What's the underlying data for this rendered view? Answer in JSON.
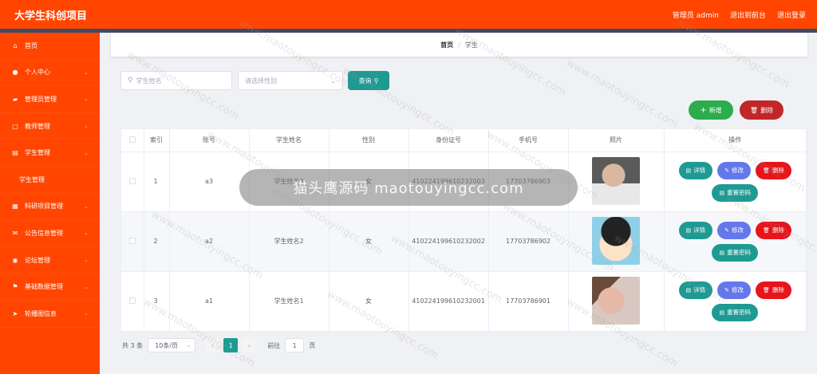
{
  "header": {
    "title": "大学生科创项目",
    "admin_label": "管理员 admin",
    "back_label": "退出到前台",
    "logout_label": "退出登录"
  },
  "sidebar": {
    "items": [
      {
        "label": "首页",
        "icon": "home-icon",
        "glyph": "⌂",
        "sub": false,
        "chevron": false
      },
      {
        "label": "个人中心",
        "icon": "user-icon",
        "glyph": "●",
        "sub": false,
        "chevron": true
      },
      {
        "label": "管理员管理",
        "icon": "admin-icon",
        "glyph": "▰",
        "sub": false,
        "chevron": true
      },
      {
        "label": "教师管理",
        "icon": "teacher-icon",
        "glyph": "□",
        "sub": false,
        "chevron": true
      },
      {
        "label": "学生管理",
        "icon": "student-icon",
        "glyph": "▤",
        "sub": false,
        "chevron": true
      },
      {
        "label": "学生管理",
        "icon": "",
        "glyph": "",
        "sub": true,
        "chevron": false
      },
      {
        "label": "科研项目管理",
        "icon": "project-icon",
        "glyph": "▦",
        "sub": false,
        "chevron": true
      },
      {
        "label": "公告信息管理",
        "icon": "notice-icon",
        "glyph": "✉",
        "sub": false,
        "chevron": true
      },
      {
        "label": "论坛管理",
        "icon": "forum-icon",
        "glyph": "◉",
        "sub": false,
        "chevron": true
      },
      {
        "label": "基础数据管理",
        "icon": "flag-icon",
        "glyph": "⚑",
        "sub": false,
        "chevron": true
      },
      {
        "label": "轮播图信息",
        "icon": "send-icon",
        "glyph": "➤",
        "sub": false,
        "chevron": true
      }
    ]
  },
  "breadcrumb": {
    "home": "首页",
    "separator": "/",
    "current": "学生"
  },
  "search": {
    "placeholder": "学生姓名",
    "gender_placeholder": "请选择性别",
    "query_label": "查询"
  },
  "actions": {
    "add_label": "新增",
    "delete_label": "删除"
  },
  "table": {
    "headers": [
      "",
      "索引",
      "账号",
      "学生姓名",
      "性别",
      "身份证号",
      "手机号",
      "照片",
      "操作"
    ],
    "rows": [
      {
        "index": "1",
        "account": "a3",
        "name": "学生姓名3",
        "gender": "女",
        "id_card": "410224199610232003",
        "phone": "17703786903",
        "photo": "photo-man-mirror"
      },
      {
        "index": "2",
        "account": "a2",
        "name": "学生姓名2",
        "gender": "女",
        "id_card": "410224199610232002",
        "phone": "17703786902",
        "photo": "photo-cartoon-boy"
      },
      {
        "index": "3",
        "account": "a1",
        "name": "学生姓名1",
        "gender": "女",
        "id_card": "410224199610232001",
        "phone": "17703786901",
        "photo": "photo-woman-lying"
      }
    ],
    "op_labels": {
      "detail": "详情",
      "edit": "修改",
      "delete": "删除",
      "reset": "重置密码"
    }
  },
  "pagination": {
    "total": "共 3 条",
    "page_size": "10条/页",
    "current_page": "1",
    "goto": "前往",
    "goto_value": "1",
    "page_unit": "页"
  },
  "watermark": {
    "pill_text": "猫头鹰源码 maotouyingcc.com",
    "tile_text": "www.maotouyingcc.com"
  },
  "colors": {
    "header": "#ff4500",
    "sidebar": "#ff4500",
    "teal": "#1e9a93",
    "green": "#2bad4b",
    "red": "#c12628",
    "purple": "#6478ec"
  }
}
